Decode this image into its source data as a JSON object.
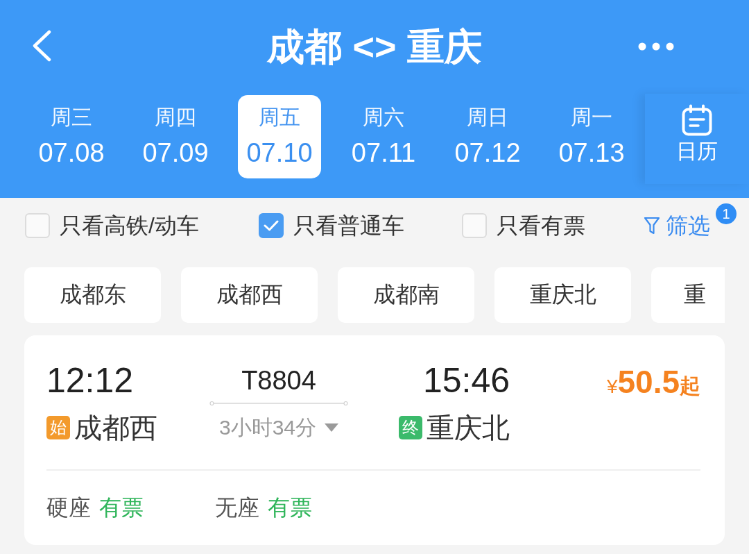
{
  "header": {
    "title": "成都 <> 重庆"
  },
  "dates": [
    {
      "weekday": "周三",
      "date": "07.08",
      "selected": false
    },
    {
      "weekday": "周四",
      "date": "07.09",
      "selected": false
    },
    {
      "weekday": "周五",
      "date": "07.10",
      "selected": true
    },
    {
      "weekday": "周六",
      "date": "07.11",
      "selected": false
    },
    {
      "weekday": "周日",
      "date": "07.12",
      "selected": false
    },
    {
      "weekday": "周一",
      "date": "07.13",
      "selected": false
    }
  ],
  "calendar": {
    "label": "日历"
  },
  "filters": [
    {
      "label": "只看高铁/动车",
      "checked": false
    },
    {
      "label": "只看普通车",
      "checked": true
    },
    {
      "label": "只看有票",
      "checked": false
    }
  ],
  "filter_button": {
    "label": "筛选",
    "badge": "1"
  },
  "stations": [
    "成都东",
    "成都西",
    "成都南",
    "重庆北",
    "重"
  ],
  "train": {
    "departure": {
      "time": "12:12",
      "badge": "始",
      "station": "成都西"
    },
    "number": "T8804",
    "duration": "3小时34分",
    "arrival": {
      "time": "15:46",
      "badge": "终",
      "station": "重庆北"
    },
    "price": {
      "currency": "¥",
      "amount": "50.5",
      "suffix": "起"
    },
    "seats": [
      {
        "name": "硬座",
        "status": "有票"
      },
      {
        "name": "无座",
        "status": "有票"
      }
    ]
  }
}
